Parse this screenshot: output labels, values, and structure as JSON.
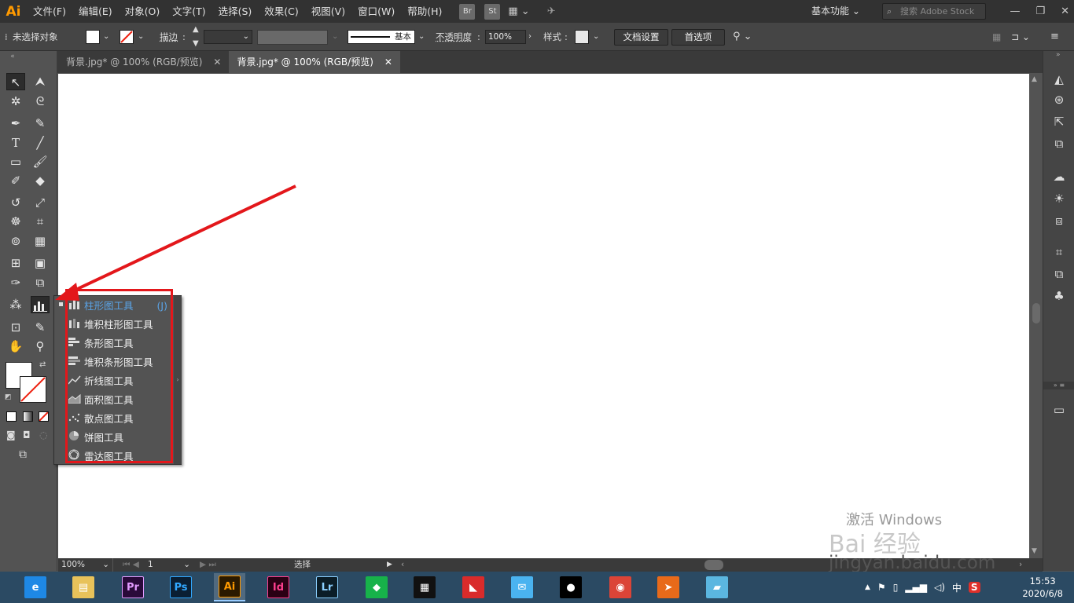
{
  "app": {
    "logo": "Ai",
    "brand_color": "#ff9a00"
  },
  "menu": [
    "文件(F)",
    "编辑(E)",
    "对象(O)",
    "文字(T)",
    "选择(S)",
    "效果(C)",
    "视图(V)",
    "窗口(W)",
    "帮助(H)"
  ],
  "menubar": {
    "bridge": "Br",
    "stock": "St",
    "workspace": "基本功能",
    "search_placeholder": "搜索 Adobe Stock"
  },
  "control": {
    "selection": "未选择对象",
    "stroke_label": "描边",
    "stroke_profile": "基本",
    "opacity_label": "不透明度",
    "opacity_value": "100%",
    "style_label": "样式",
    "doc_setup": "文档设置",
    "preferences": "首选项"
  },
  "tabs": [
    {
      "label": "背景.jpg* @ 100% (RGB/预览)",
      "active": false
    },
    {
      "label": "背景.jpg* @ 100% (RGB/预览)",
      "active": true
    }
  ],
  "flyout": {
    "items": [
      {
        "label": "柱形图工具",
        "shortcut": "(J)",
        "icon": "column-graph-icon",
        "selected": true
      },
      {
        "label": "堆积柱形图工具",
        "icon": "stacked-column-graph-icon"
      },
      {
        "label": "条形图工具",
        "icon": "bar-graph-icon"
      },
      {
        "label": "堆积条形图工具",
        "icon": "stacked-bar-graph-icon"
      },
      {
        "label": "折线图工具",
        "icon": "line-graph-icon"
      },
      {
        "label": "面积图工具",
        "icon": "area-graph-icon"
      },
      {
        "label": "散点图工具",
        "icon": "scatter-graph-icon"
      },
      {
        "label": "饼图工具",
        "icon": "pie-graph-icon"
      },
      {
        "label": "雷达图工具",
        "icon": "radar-graph-icon"
      }
    ],
    "highlight_color": "#e3171b"
  },
  "status": {
    "zoom": "100%",
    "artboard": "1",
    "tool": "选择"
  },
  "taskbar": {
    "apps": [
      {
        "name": "ie-browser",
        "label": "e",
        "color": "#1e88e5"
      },
      {
        "name": "file-explorer",
        "label": "▤",
        "color": "#e8c25a"
      },
      {
        "name": "premiere",
        "label": "Pr",
        "color": "#2a0a3a",
        "fg": "#e39bff"
      },
      {
        "name": "photoshop",
        "label": "Ps",
        "color": "#0a1f33",
        "fg": "#31a8ff"
      },
      {
        "name": "illustrator",
        "label": "Ai",
        "color": "#2b1a00",
        "fg": "#ff9a00",
        "active": true
      },
      {
        "name": "indesign",
        "label": "Id",
        "color": "#2a0014",
        "fg": "#ff3e8e"
      },
      {
        "name": "lightroom",
        "label": "Lr",
        "color": "#0b1d27",
        "fg": "#8bd0ff"
      },
      {
        "name": "green-app",
        "label": "◆",
        "color": "#17b24a"
      },
      {
        "name": "video-app",
        "label": "▦",
        "color": "#111"
      },
      {
        "name": "red-app",
        "label": "◣",
        "color": "#d92b2b"
      },
      {
        "name": "qq-chat",
        "label": "✉",
        "color": "#4ab3f0"
      },
      {
        "name": "qq-penguin",
        "label": "●",
        "color": "#000"
      },
      {
        "name": "chrome",
        "label": "◉",
        "color": "#db4437"
      },
      {
        "name": "orange-app",
        "label": "➤",
        "color": "#e86a1a"
      },
      {
        "name": "blue-app",
        "label": "▰",
        "color": "#5bb6e0"
      }
    ],
    "ime": "中",
    "time": "15:53",
    "date": "2020/6/8"
  },
  "watermark": {
    "activate": "激活 Windows",
    "site": "jingyan.baidu.com",
    "brand": "Bai 经验"
  }
}
